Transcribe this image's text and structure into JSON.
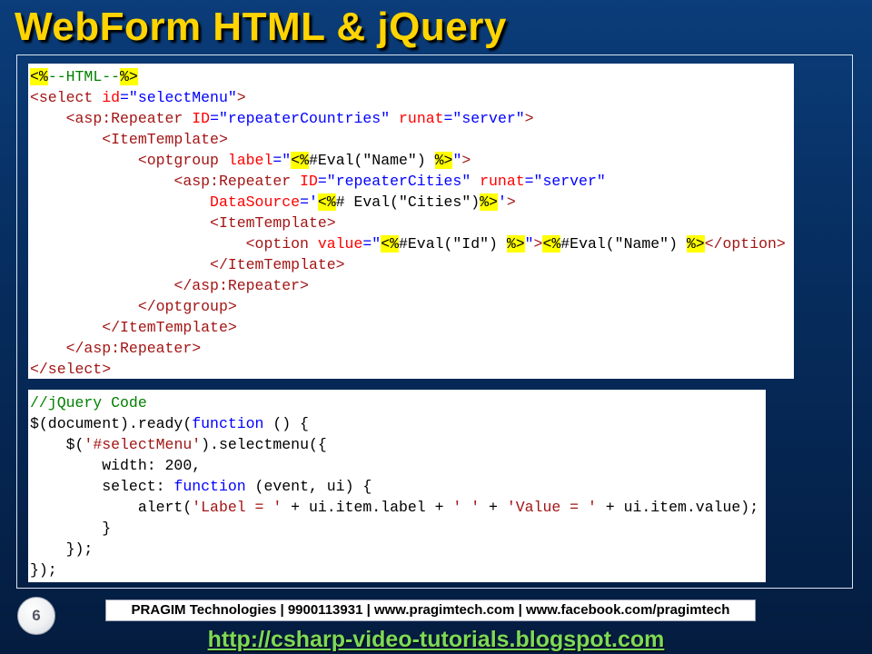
{
  "slide": {
    "title": "WebForm HTML & jQuery",
    "page_number": "6",
    "footer_text": "PRAGIM Technologies | 9900113931 | www.pragimtech.com | www.facebook.com/pragimtech",
    "blog_link": "http://csharp-video-tutorials.blogspot.com"
  },
  "colors": {
    "title": "#ffd400",
    "background_top": "#0b3d7a",
    "background_bottom": "#041c3f",
    "tag": "#a31515",
    "attribute": "#ff0000",
    "attribute_value": "#0000ff",
    "highlight": "#ffff00",
    "comment": "#008000",
    "keyword": "#0000ff",
    "string": "#a31515",
    "link": "#7ed957"
  },
  "html_code": [
    [
      {
        "t": "hl",
        "v": "<%"
      },
      {
        "t": "comment",
        "v": "--HTML--"
      },
      {
        "t": "hl",
        "v": "%>"
      }
    ],
    [
      {
        "t": "tag",
        "v": "<select"
      },
      {
        "t": "attr",
        "v": " id"
      },
      {
        "t": "val",
        "v": "=\"selectMenu\""
      },
      {
        "t": "tag",
        "v": ">"
      }
    ],
    [
      {
        "t": "default",
        "v": "    "
      },
      {
        "t": "tag",
        "v": "<asp:Repeater"
      },
      {
        "t": "attr",
        "v": " ID"
      },
      {
        "t": "val",
        "v": "=\"repeaterCountries\""
      },
      {
        "t": "attr",
        "v": " runat"
      },
      {
        "t": "val",
        "v": "=\"server\""
      },
      {
        "t": "tag",
        "v": ">"
      }
    ],
    [
      {
        "t": "default",
        "v": "        "
      },
      {
        "t": "tag",
        "v": "<ItemTemplate>"
      }
    ],
    [
      {
        "t": "default",
        "v": "            "
      },
      {
        "t": "tag",
        "v": "<optgroup"
      },
      {
        "t": "attr",
        "v": " label"
      },
      {
        "t": "val",
        "v": "=\""
      },
      {
        "t": "hl",
        "v": "<%"
      },
      {
        "t": "default",
        "v": "#Eval(\"Name\") "
      },
      {
        "t": "hl",
        "v": "%>"
      },
      {
        "t": "val",
        "v": "\""
      },
      {
        "t": "tag",
        "v": ">"
      }
    ],
    [
      {
        "t": "default",
        "v": "                "
      },
      {
        "t": "tag",
        "v": "<asp:Repeater"
      },
      {
        "t": "attr",
        "v": " ID"
      },
      {
        "t": "val",
        "v": "=\"repeaterCities\""
      },
      {
        "t": "attr",
        "v": " runat"
      },
      {
        "t": "val",
        "v": "=\"server\""
      }
    ],
    [
      {
        "t": "default",
        "v": "                    "
      },
      {
        "t": "attr",
        "v": "DataSource"
      },
      {
        "t": "val",
        "v": "='"
      },
      {
        "t": "hl",
        "v": "<%"
      },
      {
        "t": "default",
        "v": "# Eval(\"Cities\")"
      },
      {
        "t": "hl",
        "v": "%>"
      },
      {
        "t": "val",
        "v": "'"
      },
      {
        "t": "tag",
        "v": ">"
      }
    ],
    [
      {
        "t": "default",
        "v": "                    "
      },
      {
        "t": "tag",
        "v": "<ItemTemplate>"
      }
    ],
    [
      {
        "t": "default",
        "v": "                        "
      },
      {
        "t": "tag",
        "v": "<option"
      },
      {
        "t": "attr",
        "v": " value"
      },
      {
        "t": "val",
        "v": "=\""
      },
      {
        "t": "hl",
        "v": "<%"
      },
      {
        "t": "default",
        "v": "#Eval(\"Id\") "
      },
      {
        "t": "hl",
        "v": "%>"
      },
      {
        "t": "val",
        "v": "\""
      },
      {
        "t": "tag",
        "v": ">"
      },
      {
        "t": "hl",
        "v": "<%"
      },
      {
        "t": "default",
        "v": "#Eval(\"Name\") "
      },
      {
        "t": "hl",
        "v": "%>"
      },
      {
        "t": "tag",
        "v": "</option>"
      }
    ],
    [
      {
        "t": "default",
        "v": "                    "
      },
      {
        "t": "tag",
        "v": "</ItemTemplate>"
      }
    ],
    [
      {
        "t": "default",
        "v": "                "
      },
      {
        "t": "tag",
        "v": "</asp:Repeater>"
      }
    ],
    [
      {
        "t": "default",
        "v": "            "
      },
      {
        "t": "tag",
        "v": "</optgroup>"
      }
    ],
    [
      {
        "t": "default",
        "v": "        "
      },
      {
        "t": "tag",
        "v": "</ItemTemplate>"
      }
    ],
    [
      {
        "t": "default",
        "v": "    "
      },
      {
        "t": "tag",
        "v": "</asp:Repeater>"
      }
    ],
    [
      {
        "t": "tag",
        "v": "</select>"
      }
    ]
  ],
  "js_code": [
    [
      {
        "t": "comment",
        "v": "//jQuery Code"
      }
    ],
    [
      {
        "t": "default",
        "v": "$(document).ready("
      },
      {
        "t": "kw",
        "v": "function"
      },
      {
        "t": "default",
        "v": " () {"
      }
    ],
    [
      {
        "t": "default",
        "v": "    $("
      },
      {
        "t": "str",
        "v": "'#selectMenu'"
      },
      {
        "t": "default",
        "v": ").selectmenu({"
      }
    ],
    [
      {
        "t": "default",
        "v": "        width: 200,"
      }
    ],
    [
      {
        "t": "default",
        "v": "        select: "
      },
      {
        "t": "kw",
        "v": "function"
      },
      {
        "t": "default",
        "v": " (event, ui) {"
      }
    ],
    [
      {
        "t": "default",
        "v": "            alert("
      },
      {
        "t": "str",
        "v": "'Label = '"
      },
      {
        "t": "default",
        "v": " + ui.item.label + "
      },
      {
        "t": "str",
        "v": "' '"
      },
      {
        "t": "default",
        "v": " + "
      },
      {
        "t": "str",
        "v": "'Value = '"
      },
      {
        "t": "default",
        "v": " + ui.item.value);"
      }
    ],
    [
      {
        "t": "default",
        "v": "        }"
      }
    ],
    [
      {
        "t": "default",
        "v": "    });"
      }
    ],
    [
      {
        "t": "default",
        "v": "});"
      }
    ]
  ]
}
